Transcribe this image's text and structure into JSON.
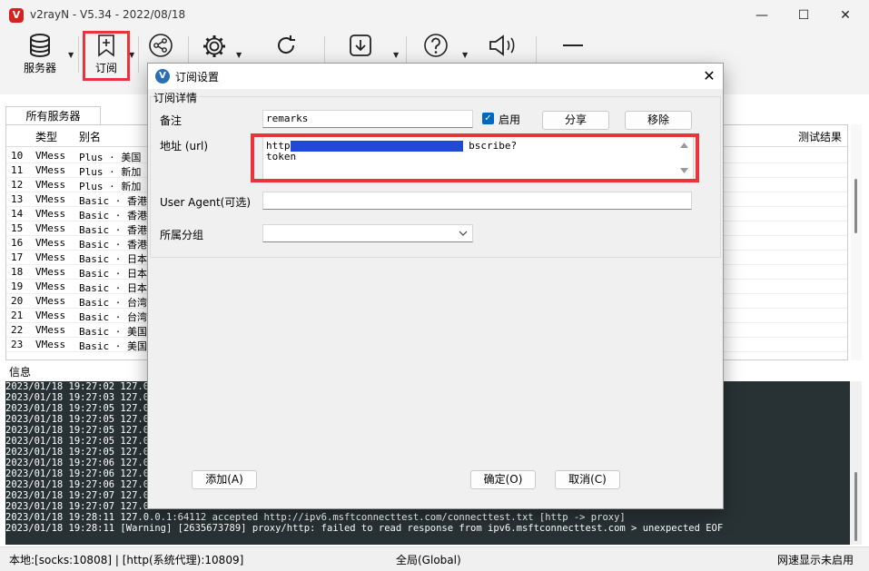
{
  "window": {
    "title": "v2rayN - V5.34 - 2022/08/18",
    "logo_letter": "V",
    "controls": [
      "—",
      "☐",
      "✕"
    ]
  },
  "toolbar": {
    "servers_label": "服务器",
    "subscription_label": "订阅"
  },
  "main": {
    "tab_label": "所有服务器",
    "columns": [
      "类型",
      "别名",
      "测试结果"
    ],
    "rows": [
      {
        "idx": "10",
        "type": "VMess",
        "alias": "Plus · 美国"
      },
      {
        "idx": "11",
        "type": "VMess",
        "alias": "Plus · 新加"
      },
      {
        "idx": "12",
        "type": "VMess",
        "alias": "Plus · 新加"
      },
      {
        "idx": "13",
        "type": "VMess",
        "alias": "Basic · 香港"
      },
      {
        "idx": "14",
        "type": "VMess",
        "alias": "Basic · 香港"
      },
      {
        "idx": "15",
        "type": "VMess",
        "alias": "Basic · 香港"
      },
      {
        "idx": "16",
        "type": "VMess",
        "alias": "Basic · 香港"
      },
      {
        "idx": "17",
        "type": "VMess",
        "alias": "Basic · 日本"
      },
      {
        "idx": "18",
        "type": "VMess",
        "alias": "Basic · 日本"
      },
      {
        "idx": "19",
        "type": "VMess",
        "alias": "Basic · 日本"
      },
      {
        "idx": "20",
        "type": "VMess",
        "alias": "Basic · 台湾"
      },
      {
        "idx": "21",
        "type": "VMess",
        "alias": "Basic · 台湾"
      },
      {
        "idx": "22",
        "type": "VMess",
        "alias": "Basic · 美国"
      },
      {
        "idx": "23",
        "type": "VMess",
        "alias": "Basic · 美国"
      }
    ],
    "info_label": "信息",
    "log_lines": [
      "2023/01/18 19:27:02 127.0.",
      "2023/01/18 19:27:03 127.0.",
      "2023/01/18 19:27:05 127.0.",
      "2023/01/18 19:27:05 127.0.",
      "2023/01/18 19:27:05 127.0.",
      "2023/01/18 19:27:05 127.0.",
      "2023/01/18 19:27:05 127.0.",
      "2023/01/18 19:27:06 127.0.",
      "2023/01/18 19:27:06 127.0.",
      "2023/01/18 19:27:06 127.0.",
      "2023/01/18 19:27:07 127.0.",
      "2023/01/18 19:27:07 127.0.",
      "2023/01/18 19:28:11 127.0.0.1:64112 accepted http://ipv6.msftconnecttest.com/connecttest.txt [http -> proxy]",
      "2023/01/18 19:28:11 [Warning] [2635673789] proxy/http: failed to read response from ipv6.msftconnecttest.com > unexpected EOF"
    ]
  },
  "status": {
    "local": "本地:[socks:10808] | [http(系统代理):10809]",
    "mode": "全局(Global)",
    "speed": "网速显示未启用"
  },
  "dialog": {
    "title": "订阅设置",
    "group_label": "订阅详情",
    "remarks_label": "备注",
    "remarks_value": "remarks",
    "enable_label": "启用",
    "enabled": true,
    "share_button": "分享",
    "remove_button": "移除",
    "url_label": "地址 (url)",
    "url_line1_prefix": "https",
    "url_line1_suffix": "bscribe?",
    "url_line2": "token",
    "ua_label": "User Agent(可选)",
    "ua_value": "",
    "group_select_label": "所属分组",
    "group_select_value": "",
    "add_button": "添加(A)",
    "ok_button": "确定(O)",
    "cancel_button": "取消(C)"
  },
  "colors": {
    "highlight": "#e9343e",
    "redaction": "#2149d6",
    "log_bg": "#283234",
    "accent": "#0067c0"
  }
}
